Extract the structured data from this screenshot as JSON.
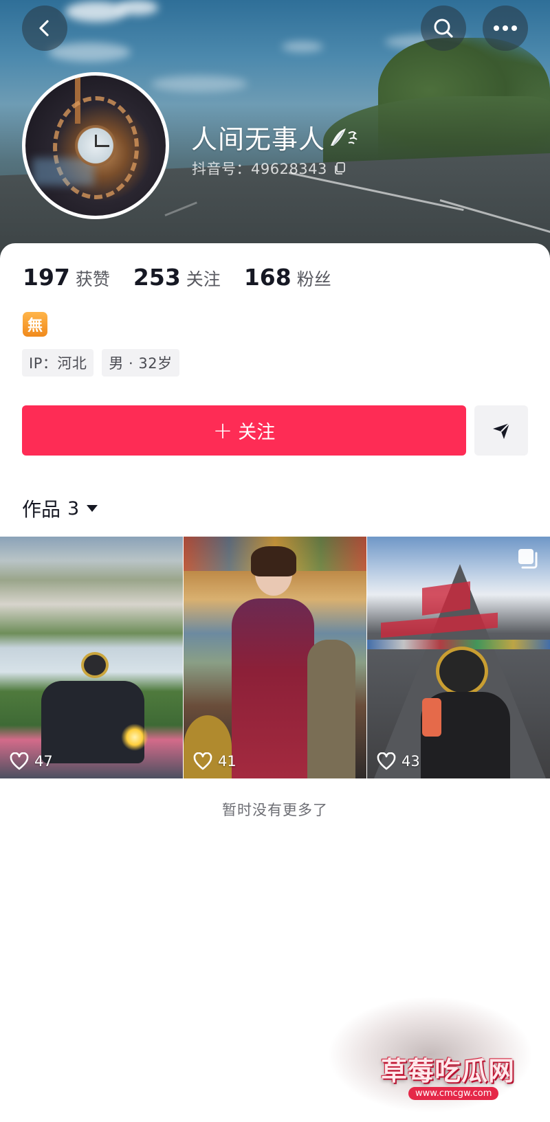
{
  "header": {
    "back_icon": "chevron-left-icon",
    "search_icon": "search-icon",
    "more_icon": "more-horizontal-icon"
  },
  "profile": {
    "nickname": "人间无事人",
    "douyin_id": "抖音号：49628343",
    "avatar": "avatar-clock-tower-night"
  },
  "stats": [
    {
      "value": "197",
      "label": "获赞"
    },
    {
      "value": "253",
      "label": "关注"
    },
    {
      "value": "168",
      "label": "粉丝"
    }
  ],
  "badge": {
    "text": "無",
    "color": "#f5a02b"
  },
  "tags": [
    {
      "text": "IP：河北"
    },
    {
      "text": "男 · 32岁"
    }
  ],
  "actions": {
    "follow_label": "关注",
    "follow_color": "#fe2c55",
    "message_icon": "send-icon"
  },
  "works": {
    "label": "作品",
    "count": "3",
    "items": [
      {
        "likes": "47",
        "multi": false
      },
      {
        "likes": "41",
        "multi": false
      },
      {
        "likes": "43",
        "multi": true
      }
    ],
    "end_text": "暂时没有更多了"
  },
  "watermark": {
    "text": "草莓吃瓜网",
    "url": "www.cmcgw.com"
  }
}
